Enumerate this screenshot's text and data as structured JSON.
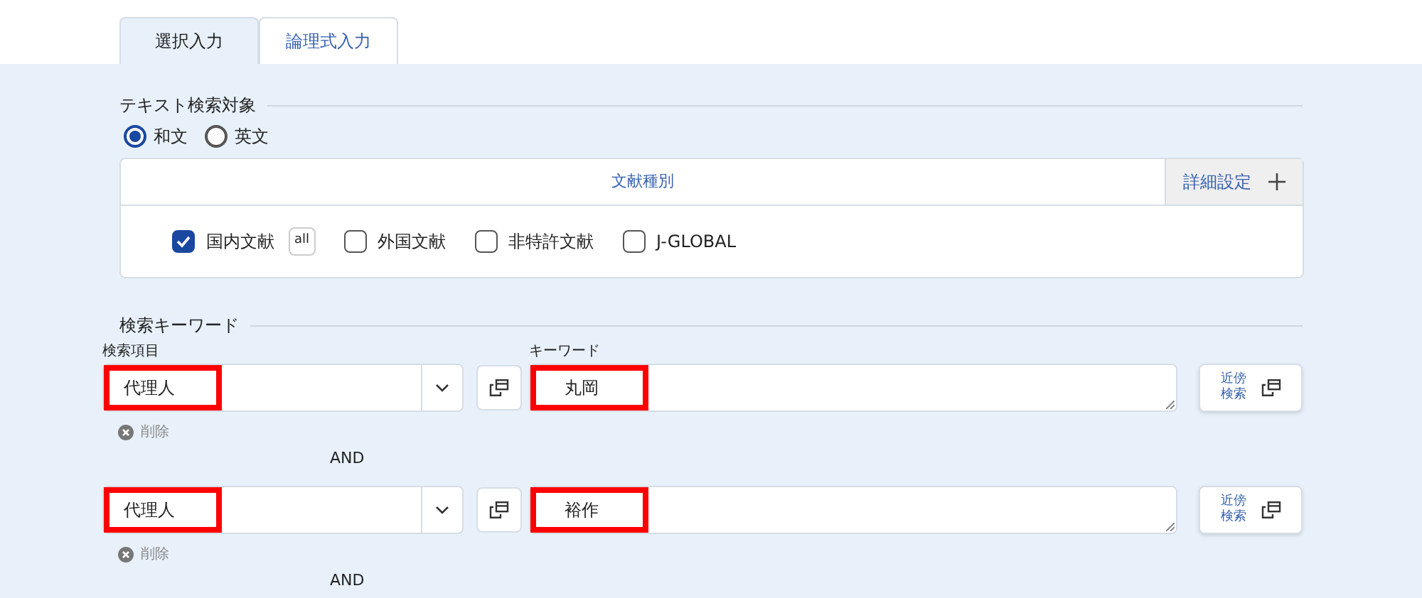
{
  "tabs": [
    {
      "label": "選択入力",
      "selected": true
    },
    {
      "label": "論理式入力",
      "selected": false
    }
  ],
  "text_target": {
    "legend": "テキスト検索対象",
    "options": [
      {
        "label": "和文",
        "selected": true
      },
      {
        "label": "英文",
        "selected": false
      }
    ]
  },
  "doc_type": {
    "title": "文献種別",
    "detail_button": "詳細設定",
    "all_badge": "all",
    "items": [
      {
        "label": "国内文献",
        "checked": true
      },
      {
        "label": "外国文献",
        "checked": false
      },
      {
        "label": "非特許文献",
        "checked": false
      },
      {
        "label": "J-GLOBAL",
        "checked": false
      }
    ]
  },
  "keywords": {
    "legend": "検索キーワード",
    "item_header": "検索項目",
    "keyword_header": "キーワード",
    "rows": [
      {
        "item": "代理人",
        "keyword": "丸岡",
        "delete": "削除",
        "operator": "AND",
        "near": "近傍検索"
      },
      {
        "item": "代理人",
        "keyword": "裕作",
        "delete": "削除",
        "operator": "AND",
        "near": "近傍検索"
      }
    ]
  }
}
